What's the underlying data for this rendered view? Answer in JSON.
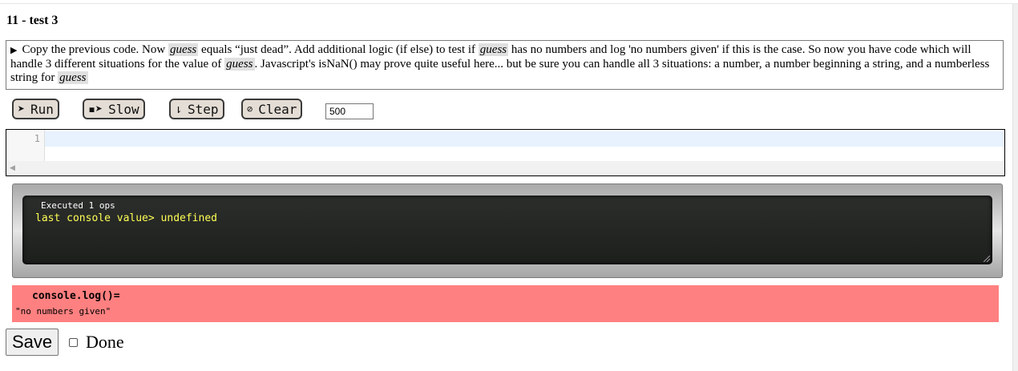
{
  "page": {
    "title": "11 - test 3"
  },
  "instructions": {
    "p1": "Copy the previous code. Now ",
    "guess1": "guess",
    "p2": " equals “just dead”. Add additional logic (if else) to test if ",
    "guess2": "guess",
    "p3": " has no numbers and log 'no numbers given' if this is the case. So now you have code which will handle 3 different situations for the value of ",
    "guess3": "guess",
    "p4": ". Javascript's isNaN() may prove quite useful here... but be sure you can handle all 3 situations: a number, a number beginning a string, and a numberless string for ",
    "guess4": "guess"
  },
  "toolbar": {
    "run_label": "Run",
    "run_icon": "➤",
    "slow_label": "Slow",
    "slow_icon": "▪➤",
    "step_label": "Step",
    "step_icon": "⇂",
    "clear_label": "Clear",
    "clear_icon": "⊘",
    "delay_value": "500"
  },
  "editor": {
    "line_number": "1"
  },
  "console": {
    "ops_text": "Executed 1 ops",
    "last_label": "last console value> ",
    "last_value": "undefined"
  },
  "expected": {
    "header": "console.log()=",
    "value": "\"no numbers given\""
  },
  "footer": {
    "save_label": "Save",
    "done_label": "Done"
  },
  "colors": {
    "expected_bg": "#ff8080",
    "console_text": "#ffff55",
    "button_bg": "#e4ddd5"
  }
}
